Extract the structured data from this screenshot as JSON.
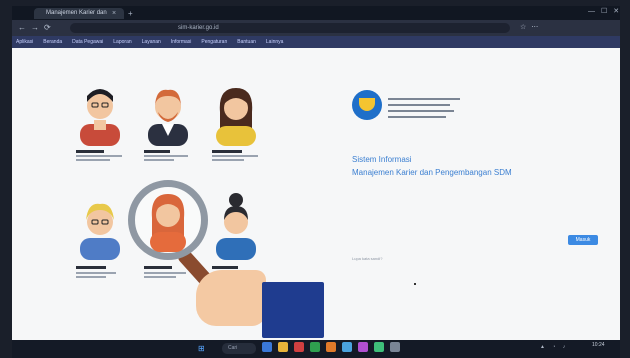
{
  "browser": {
    "tab_title": "Manajemen Karier dan Pengembangan SDM",
    "tab_close": "×",
    "new_tab": "+",
    "url": "sim-karier.go.id",
    "bookmarks": [
      "Aplikasi",
      "Beranda",
      "Data Pegawai",
      "Laporan",
      "Layanan",
      "Informasi",
      "Pengaturan",
      "Bantuan",
      "Lainnya"
    ]
  },
  "page": {
    "title_line1": "Sistem Informasi",
    "title_line2": "Manajemen Karier dan Pengembangan SDM",
    "login_button": "Masuk",
    "footer_link": "Lupa kata sandi?"
  },
  "taskbar": {
    "search_placeholder": "Cari",
    "clock": "10:24"
  },
  "colors": {
    "accent": "#3b7fd1",
    "button": "#3c8ae3",
    "bookmarks_bar": "#2f3a63"
  }
}
